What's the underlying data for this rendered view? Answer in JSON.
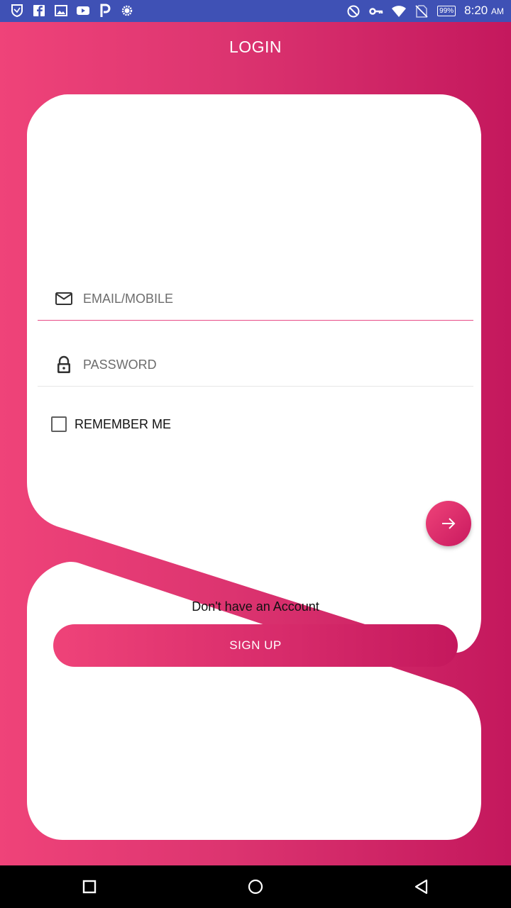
{
  "status_bar": {
    "left_icons": [
      "shield-icon",
      "facebook-icon",
      "image-icon",
      "youtube-icon",
      "p-icon",
      "settings-icon"
    ],
    "right_icons": [
      "do-not-disturb-icon",
      "key-icon",
      "wifi-icon",
      "no-sim-icon",
      "battery-icon"
    ],
    "battery": "99%",
    "time": "8:20",
    "ampm": "AM"
  },
  "header": {
    "title": "LOGIN"
  },
  "form": {
    "email_placeholder": "EMAIL/MOBILE",
    "email_value": "",
    "password_placeholder": "PASSWORD",
    "password_value": "",
    "remember_label": "REMEMBER ME",
    "remember_checked": false,
    "submit_icon": "arrow-right-icon"
  },
  "signup_section": {
    "prompt": "Don't have an Account",
    "button_label": "SIGN UP"
  },
  "nav": {
    "icons": [
      "recents-square-icon",
      "home-circle-icon",
      "back-triangle-icon"
    ]
  },
  "colors": {
    "status_bar": "#3f51b5",
    "gradient_start": "#ef4379",
    "gradient_end": "#c4185d",
    "focus_line": "#e84b86",
    "card": "#ffffff"
  }
}
